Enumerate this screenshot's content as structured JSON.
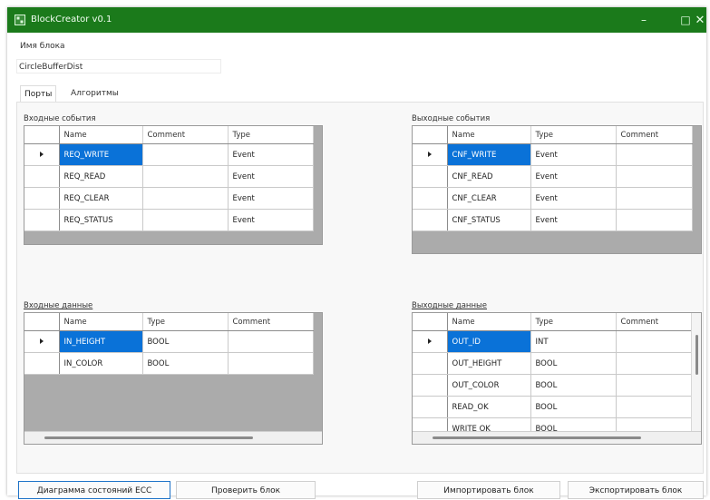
{
  "window": {
    "title": "BlockCreator v0.1",
    "minimize": "–",
    "maximize": "□",
    "close": "✕"
  },
  "block_name": {
    "label": "Имя блока",
    "value": "CircleBufferDist"
  },
  "tabs": [
    {
      "label": "Порты"
    },
    {
      "label": "Алгоритмы"
    }
  ],
  "input_events": {
    "label": "Входные события",
    "columns": [
      "Name",
      "Comment",
      "Type"
    ],
    "rows": [
      {
        "name": "REQ_WRITE",
        "comment": "",
        "type": "Event"
      },
      {
        "name": "REQ_READ",
        "comment": "",
        "type": "Event"
      },
      {
        "name": "REQ_CLEAR",
        "comment": "",
        "type": "Event"
      },
      {
        "name": "REQ_STATUS",
        "comment": "",
        "type": "Event"
      }
    ]
  },
  "output_events": {
    "label": "Выходные события",
    "columns": [
      "Name",
      "Type",
      "Comment"
    ],
    "rows": [
      {
        "name": "CNF_WRITE",
        "type": "Event",
        "comment": ""
      },
      {
        "name": "CNF_READ",
        "type": "Event",
        "comment": ""
      },
      {
        "name": "CNF_CLEAR",
        "type": "Event",
        "comment": ""
      },
      {
        "name": "CNF_STATUS",
        "type": "Event",
        "comment": ""
      }
    ]
  },
  "input_data": {
    "label": "Входные данные",
    "columns": [
      "Name",
      "Type",
      "Comment"
    ],
    "rows": [
      {
        "name": "IN_HEIGHT",
        "type": "BOOL",
        "comment": ""
      },
      {
        "name": "IN_COLOR",
        "type": "BOOL",
        "comment": ""
      }
    ]
  },
  "output_data": {
    "label": "Выходные данные",
    "columns": [
      "Name",
      "Type",
      "Comment"
    ],
    "rows": [
      {
        "name": "OUT_ID",
        "type": "INT",
        "comment": ""
      },
      {
        "name": "OUT_HEIGHT",
        "type": "BOOL",
        "comment": ""
      },
      {
        "name": "OUT_COLOR",
        "type": "BOOL",
        "comment": ""
      },
      {
        "name": "READ_OK",
        "type": "BOOL",
        "comment": ""
      },
      {
        "name": "WRITE OK",
        "type": "BOOL",
        "comment": ""
      }
    ]
  },
  "buttons": {
    "ecc": "Диаграмма состояний ECC",
    "check": "Проверить блок",
    "import": "Импортировать блок",
    "export": "Экспортировать блок"
  },
  "colors": {
    "titlebar": "#1b7a1b",
    "selection": "#0a72d8",
    "grid_empty": "#ababab"
  }
}
